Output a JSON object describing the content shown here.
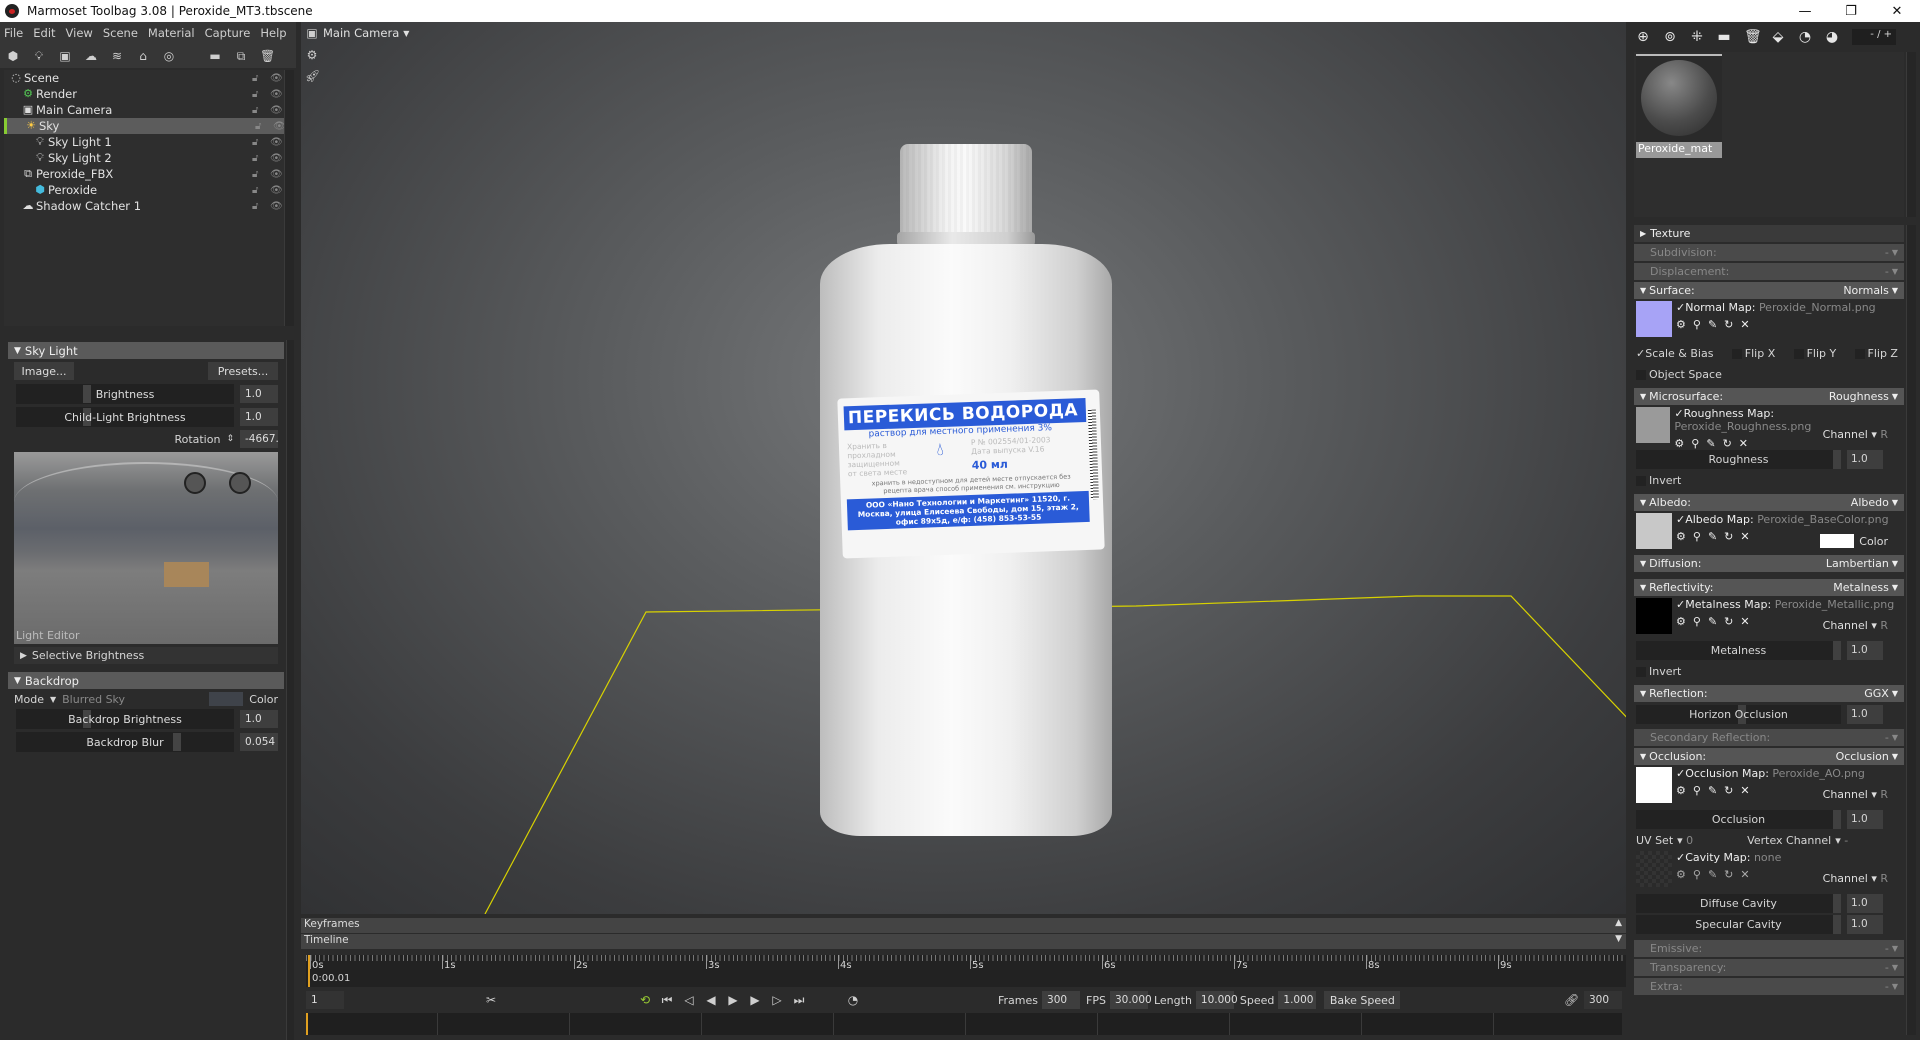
{
  "window": {
    "title": "Marmoset Toolbag 3.08  |  Peroxide_MT3.tbscene",
    "minimize": "—",
    "maximize": "❐",
    "close": "✕"
  },
  "menu": [
    "File",
    "Edit",
    "View",
    "Scene",
    "Material",
    "Capture",
    "Help"
  ],
  "left_toolbar": [
    "mesh-icon",
    "light-icon",
    "camera-icon",
    "shadow-catcher-icon",
    "sky-icon",
    "house-icon",
    "turntable-icon",
    "folder-icon",
    "duplicate-icon",
    "trash-icon"
  ],
  "scene_tree": [
    {
      "label": "Scene",
      "icon": "scene-icon",
      "indent": 0,
      "selected": false
    },
    {
      "label": "Render",
      "icon": "render-gear-icon",
      "indent": 1,
      "selected": false
    },
    {
      "label": "Main Camera",
      "icon": "camera-icon",
      "indent": 1,
      "selected": false
    },
    {
      "label": "Sky",
      "icon": "sky-icon",
      "indent": 1,
      "selected": true
    },
    {
      "label": "Sky Light 1",
      "icon": "bulb-icon",
      "indent": 2,
      "selected": false
    },
    {
      "label": "Sky Light 2",
      "icon": "bulb-icon",
      "indent": 2,
      "selected": false
    },
    {
      "label": "Peroxide_FBX",
      "icon": "fbx-icon",
      "indent": 1,
      "selected": false
    },
    {
      "label": "Peroxide",
      "icon": "mesh-icon",
      "indent": 2,
      "selected": false
    },
    {
      "label": "Shadow Catcher 1",
      "icon": "shadow-catcher-icon",
      "indent": 1,
      "selected": false
    }
  ],
  "sky_light": {
    "header": "Sky Light",
    "image_btn": "Image...",
    "presets_btn": "Presets...",
    "brightness_label": "Brightness",
    "brightness": "1.0",
    "child_label": "Child-Light Brightness",
    "child": "1.0",
    "rotation_label": "Rotation",
    "rotation": "-4667.",
    "light_editor": "Light Editor",
    "selective": "Selective Brightness"
  },
  "backdrop": {
    "header": "Backdrop",
    "mode_label": "Mode",
    "mode": "Blurred Sky",
    "color_label": "Color",
    "brightness_label": "Backdrop Brightness",
    "brightness": "1.0",
    "blur_label": "Backdrop Blur",
    "blur": "0.054"
  },
  "viewport": {
    "camera": "Main Camera",
    "label": {
      "title": "ПЕРЕКИСЬ ВОДОРОДА",
      "subtitle": "раствор для местного применения 3%",
      "storage": "Хранить в прохладном защищенном от света месте",
      "reg": "Р № 002554/01-2003 Дата выпуска V.16",
      "volume": "40 мл",
      "note": "хранить в недоступном для детей месте отпускается без рецепта врача способ применения см. инструкцию",
      "maker": "ООО «Нано Технологии и Маркетинг» 11520, г. Москва, улица Елисеева Свободы, дом 15, этаж 2, офис 89х5д, е/ф: (458) 853-53-55"
    },
    "accent": "#2a5bd7",
    "shadow_catcher_color": "#d8d200"
  },
  "right_toolbar": {
    "icons": [
      "add-material-icon",
      "duplicate-material-icon",
      "checker-icon",
      "folder-icon",
      "trash-icon",
      "pick-icon",
      "export-icon",
      "import-icon"
    ],
    "counter": "- / +"
  },
  "material": {
    "name": "Peroxide_mat"
  },
  "props": {
    "texture": "Texture",
    "subdivision": {
      "label": "Subdivision:",
      "value": "-"
    },
    "displacement": {
      "label": "Displacement:",
      "value": "-"
    },
    "surface": {
      "label": "Surface:",
      "value": "Normals",
      "map_label": "Normal Map:",
      "map": "Peroxide_Normal.png",
      "scale_bias": "Scale & Bias",
      "flip_x": "Flip X",
      "flip_y": "Flip Y",
      "flip_z": "Flip Z",
      "object_space": "Object Space"
    },
    "microsurface": {
      "label": "Microsurface:",
      "value": "Roughness",
      "map_label": "Roughness Map:",
      "map": "Peroxide_Roughness.png",
      "channel": "Channel",
      "channel_val": "R",
      "slider": "Roughness",
      "num": "1.0",
      "invert": "Invert"
    },
    "albedo": {
      "label": "Albedo:",
      "value": "Albedo",
      "map_label": "Albedo Map:",
      "map": "Peroxide_BaseColor.png",
      "color": "Color"
    },
    "diffusion": {
      "label": "Diffusion:",
      "value": "Lambertian"
    },
    "reflectivity": {
      "label": "Reflectivity:",
      "value": "Metalness",
      "map_label": "Metalness Map:",
      "map": "Peroxide_Metallic.png",
      "channel": "Channel",
      "channel_val": "R",
      "slider": "Metalness",
      "num": "1.0",
      "invert": "Invert"
    },
    "reflection": {
      "label": "Reflection:",
      "value": "GGX",
      "slider": "Horizon Occlusion",
      "num": "1.0"
    },
    "secondary": {
      "label": "Secondary Reflection:",
      "value": "-"
    },
    "occlusion": {
      "label": "Occlusion:",
      "value": "Occlusion",
      "map_label": "Occlusion Map:",
      "map": "Peroxide_AO.png",
      "channel": "Channel",
      "channel_val": "R",
      "slider": "Occlusion",
      "num": "1.0",
      "uv_label": "UV Set",
      "uv": "0",
      "vc_label": "Vertex Channel",
      "vc": "-",
      "cavity_label": "Cavity Map:",
      "cavity": "none",
      "cav_channel": "Channel",
      "cav_channel_val": "R",
      "diffuse_cavity": "Diffuse Cavity",
      "diffuse_num": "1.0",
      "specular_cavity": "Specular Cavity",
      "specular_num": "1.0"
    },
    "emissive": {
      "label": "Emissive:",
      "value": "-"
    },
    "transparency": {
      "label": "Transparency:",
      "value": "-"
    },
    "extra": {
      "label": "Extra:",
      "value": "-"
    }
  },
  "timeline": {
    "keyframes": "Keyframes",
    "timeline": "Timeline",
    "ticks": [
      "0s",
      "1s",
      "2s",
      "3s",
      "4s",
      "5s",
      "6s",
      "7s",
      "8s",
      "9s"
    ],
    "current_time": "0:00.01",
    "frame": "1",
    "frames_label": "Frames",
    "frames": "300",
    "fps_label": "FPS",
    "fps": "30.000",
    "length_label": "Length",
    "length": "10.000",
    "speed_label": "Speed",
    "speed": "1.000",
    "bake_speed": "Bake Speed",
    "end_frame": "300"
  }
}
